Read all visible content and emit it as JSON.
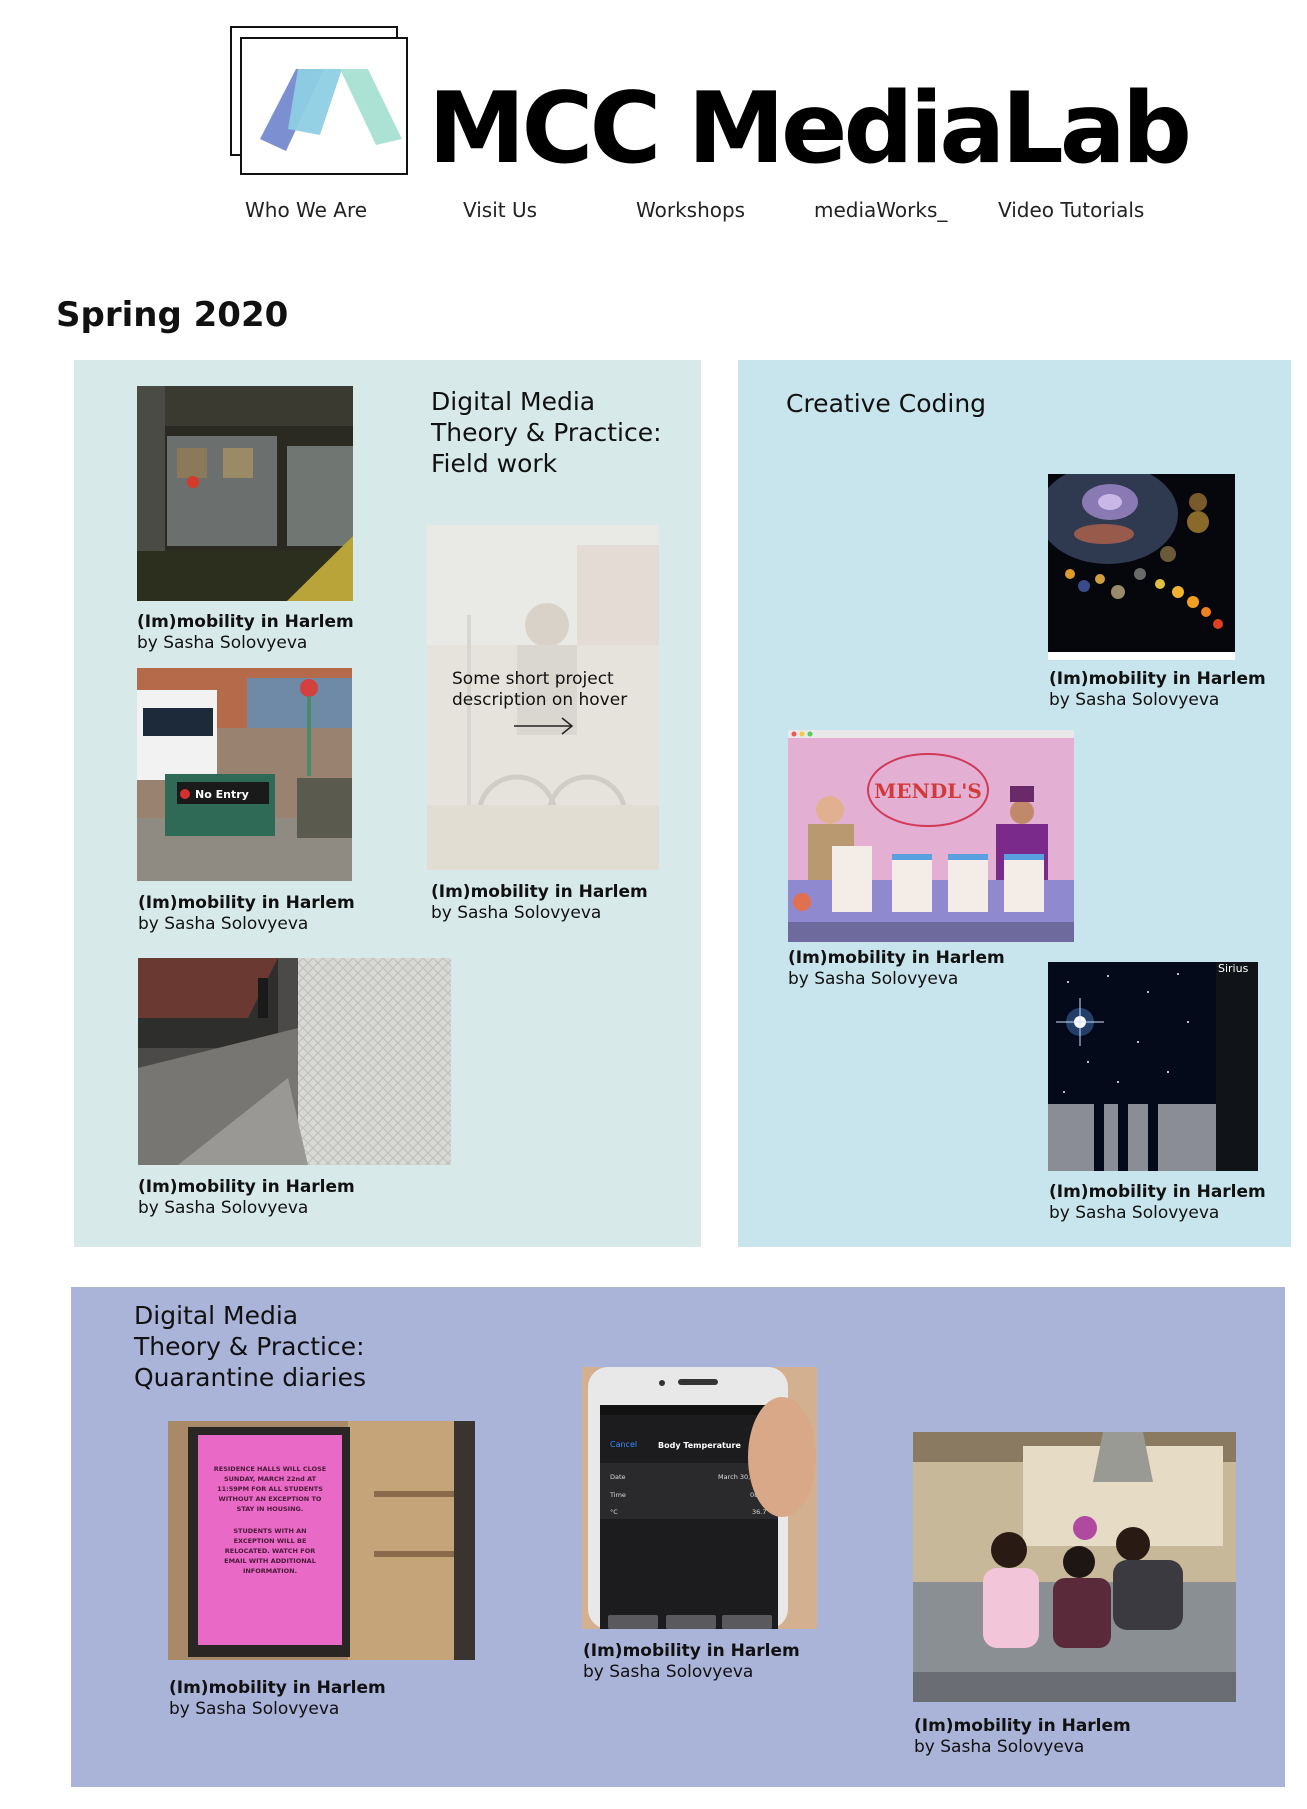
{
  "header": {
    "brand": "MCC MediaLab",
    "nav": [
      "Who We Are",
      "Visit Us",
      "Workshops",
      "mediaWorks_",
      "Video Tutorials"
    ]
  },
  "season": "Spring 2020",
  "sections": {
    "fieldwork": {
      "title": [
        "Digital Media",
        "Theory & Practice:",
        "Field work"
      ],
      "hover_text": [
        "Some short project",
        "description on hover"
      ]
    },
    "creative_coding": {
      "title": [
        "Creative Coding"
      ]
    },
    "quarantine": {
      "title": [
        "Digital Media",
        "Theory & Practice:",
        "Quarantine diaries"
      ]
    }
  },
  "projects": [
    {
      "title": "(Im)mobility in Harlem",
      "author": "by Sasha Solovyeva"
    },
    {
      "title": "(Im)mobility in Harlem",
      "author": "by Sasha Solovyeva"
    },
    {
      "title": "(Im)mobility in Harlem",
      "author": "by Sasha Solovyeva"
    },
    {
      "title": "(Im)mobility in Harlem",
      "author": "by Sasha Solovyeva"
    },
    {
      "title": "(Im)mobility in Harlem",
      "author": "by Sasha Solovyeva"
    },
    {
      "title": "(Im)mobility in Harlem",
      "author": "by Sasha Solovyeva"
    },
    {
      "title": "(Im)mobility in Harlem",
      "author": "by Sasha Solovyeva"
    },
    {
      "title": "(Im)mobility in Harlem",
      "author": "by Sasha Solovyeva"
    },
    {
      "title": "(Im)mobility in Harlem",
      "author": "by Sasha Solovyeva"
    },
    {
      "title": "(Im)mobility in Harlem",
      "author": "by Sasha Solovyeva"
    }
  ],
  "image_text": {
    "no_entry": "No Entry",
    "mendls": "MENDL'S",
    "sirius": "Sirius",
    "phone_cancel": "Cancel",
    "phone_title": "Body Temperature",
    "phone_date_label": "Date",
    "phone_time_label": "Time",
    "phone_temp_label": "°C",
    "phone_date": "March 30, 20",
    "phone_time": "08:21",
    "phone_temp": "36.7",
    "sign_line1": "RESIDENCE HALLS WILL CLOSE",
    "sign_line2": "SUNDAY, MARCH 22nd AT",
    "sign_line3": "11:59PM FOR ALL STUDENTS",
    "sign_line4": "WITHOUT AN EXCEPTION TO",
    "sign_line5": "STAY IN HOUSING.",
    "sign_line6": "STUDENTS WITH AN",
    "sign_line7": "EXCEPTION WILL BE",
    "sign_line8": "RELOCATED. WATCH FOR",
    "sign_line9": "EMAIL WITH ADDITIONAL",
    "sign_line10": "INFORMATION."
  },
  "colors": {
    "panel_fieldwork": "#d7eae9",
    "panel_coding": "#c8e4ec",
    "panel_quarantine": "#aab3d8",
    "logo_blue": "#7c8fd0",
    "logo_light_blue": "#8ecfe4",
    "logo_mint": "#a8e0d2"
  }
}
